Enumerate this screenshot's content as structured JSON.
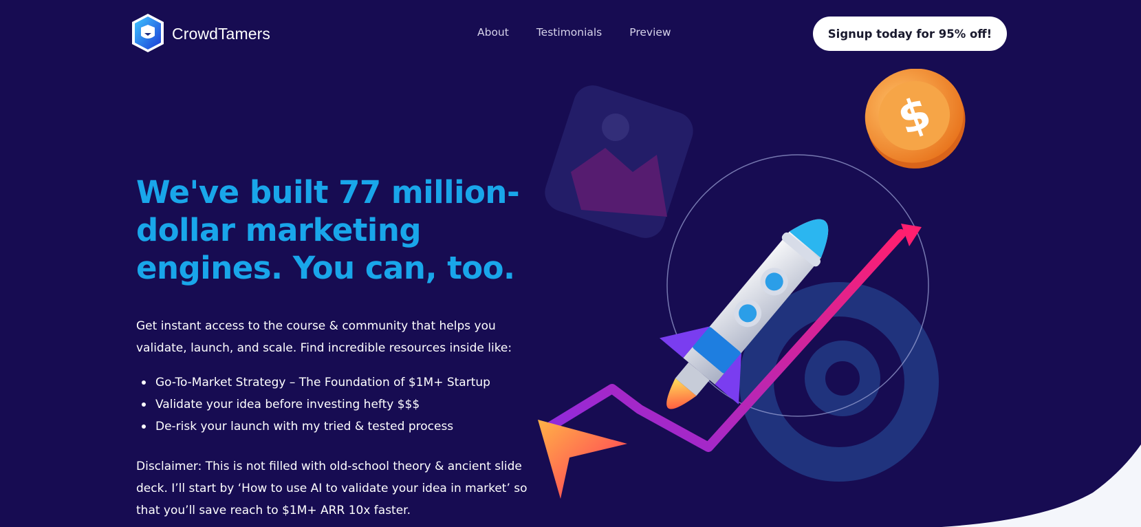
{
  "brand": {
    "name": "CrowdTamers",
    "logo_icon": "shield-fox-logo",
    "accent": "#19a6ea",
    "background": "#170c52"
  },
  "nav": {
    "items": [
      {
        "label": "About"
      },
      {
        "label": "Testimonials"
      },
      {
        "label": "Preview"
      }
    ]
  },
  "header": {
    "cta_label": "Signup today for 95% off!"
  },
  "hero": {
    "title": "We've built 77 million-dollar marketing engines. You can, too.",
    "intro": "Get instant access to the course & community that helps you validate, launch, and scale. Find incredible resources inside like:",
    "features": [
      "Go-To-Market Strategy – The Foundation of $1M+ Startup",
      "Validate your idea before investing hefty $$$",
      "De-risk your launch with my tried & tested process"
    ],
    "disclaimer": "Disclaimer: This is not filled with old-school theory & ancient slide deck. I’ll start by ‘How to use AI to validate your idea in market’ so that you’ll save reach to $1M+ ARR 10x faster."
  },
  "illustration": {
    "icons": [
      "rocket-icon",
      "dollar-coin-icon",
      "image-card-icon",
      "at-sign-icon",
      "growth-arrow-icon",
      "cursor-arrow-icon"
    ]
  }
}
